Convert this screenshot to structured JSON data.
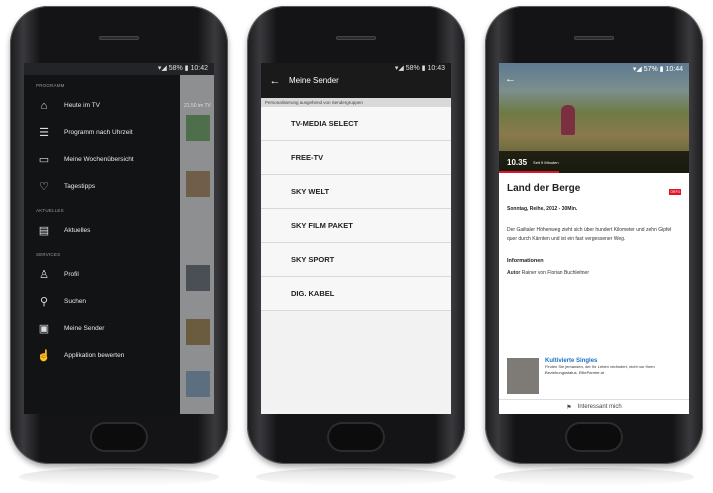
{
  "phone1": {
    "status": "▾◢ 58% ▮ 10:42",
    "sections": [
      {
        "label": "PROGRAMM",
        "items": [
          {
            "icon": "home-icon",
            "glyph": "⌂",
            "label": "Heute im TV"
          },
          {
            "icon": "list-icon",
            "glyph": "☰",
            "label": "Programm nach Uhrzeit"
          },
          {
            "icon": "tv-icon",
            "glyph": "▭",
            "label": "Meine Wochenübersicht"
          },
          {
            "icon": "heart-icon",
            "glyph": "♡",
            "label": "Tagestipps"
          }
        ]
      },
      {
        "label": "AKTUELLES",
        "items": [
          {
            "icon": "news-icon",
            "glyph": "▤",
            "label": "Aktuelles"
          }
        ]
      },
      {
        "label": "SERVICES",
        "items": [
          {
            "icon": "person-icon",
            "glyph": "♙",
            "label": "Profil"
          },
          {
            "icon": "search-icon",
            "glyph": "⚲",
            "label": "Suchen"
          },
          {
            "icon": "channels-icon",
            "glyph": "▣",
            "label": "Meine Sender"
          },
          {
            "icon": "thumb-up-icon",
            "glyph": "☝",
            "label": "Applikation bewerten"
          }
        ]
      }
    ],
    "behind_text": "21.50 im TV"
  },
  "phone2": {
    "status": "▾◢ 58% ▮ 10:43",
    "title": "Meine Sender",
    "subheader": "Personalisierung ausgehend von Sendergruppen",
    "channels": [
      "TV-MEDIA SELECT",
      "FREE-TV",
      "SKY WELT",
      "SKY FILM PAKET",
      "SKY SPORT",
      "DIG. KABEL"
    ]
  },
  "phone3": {
    "status": "▾◢ 57% ▮ 10:44",
    "time": "10.35",
    "since": "Seit 9 Minuten",
    "title": "Land der Berge",
    "badge": "ORF3",
    "meta": "Sonntag, Reihe, 2012 - 30Min.",
    "description": "Der Gailtaler Höhenweg zieht sich über hundert Kilometer und zehn Gipfel quer durch Kärnten und ist ein fast vergessener Weg.",
    "info_heading": "Informationen",
    "author_label": "Autor",
    "author_value": "Rainer von Florian Buchleitner",
    "card_title": "Kultivierte Singles",
    "card_desc": "Finden Sie jemanden, der Ihr Leben verändert, nicht nur Ihren Beziehungsstatus. EliteParnter.at",
    "bottom_label": "Interessant mich"
  }
}
